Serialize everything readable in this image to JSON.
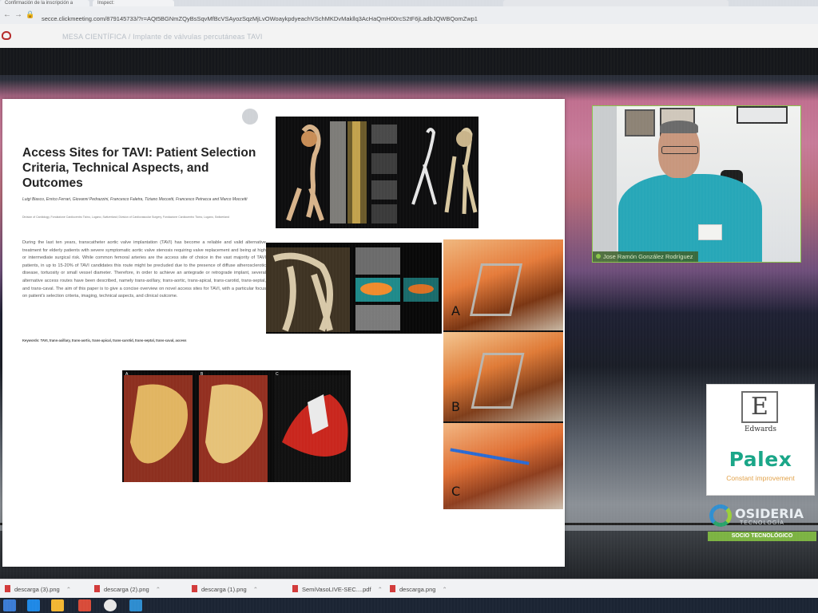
{
  "browser": {
    "tabs": [
      "Confirmación de la inscripción a",
      "Inspect:"
    ],
    "url": "secce.clickmeeting.com/879145733/?r=AQt5BGNmZQyBsSqvMfBcVSAyozSqzMjLvOWoaykpdyeachVSchMKDvMakllq3AcHaQmH00rcS2tF6jLadbJQWBQomZwp1"
  },
  "app_header": {
    "session_title": "MESA CIENTÍFICA / Implante de válvulas percutáneas TAVI"
  },
  "slide": {
    "title": "Access Sites for TAVI: Patient Selection Criteria, Technical Aspects, and Outcomes",
    "authors": "Luigi Biasco, Enrico Ferrari, Giovanni Pedrazzini, Francesco Faletra, Tiziano Moccetti, Francesco Petracca and Marco Moccetti",
    "affiliation": "Division of Cardiology, Fondazione Cardiocentro Ticino, Lugano, Switzerland; Division of Cardiovascular Surgery, Fondazione Cardiocentro Ticino, Lugano, Switzerland",
    "abstract": "During the last ten years, transcatheter aortic valve implantation (TAVI) has become a reliable and valid alternative treatment for elderly patients with severe symptomatic aortic valve stenosis requiring valve replacement and being at high or intermediate surgical risk. While common femoral arteries are the access site of choice in the vast majority of TAVI patients, in up to 15-20% of TAVI candidates this route might be precluded due to the presence of diffuse atherosclerotic disease, tortuosity or small vessel diameter. Therefore, in order to achieve an antegrade or retrograde implant, several alternative access routes have been described, namely trans-axillary, trans-aortic, trans-apical, trans-carotid, trans-septal, and trans-caval. The aim of this paper is to give a concise overview on novel access sites for TAVI, with a particular focus on patient's selection criteria, imaging, technical aspects, and clinical outcome.",
    "keywords": "Keywords: TAVI, trans-axillary, trans-aortic, trans-apical, trans-carotid, trans-septal, trans-caval, access",
    "figure_panels": [
      "A",
      "B",
      "C"
    ],
    "ct_panels": [
      "A",
      "B",
      "C"
    ]
  },
  "webcam": {
    "speaker_name": "Jose Ramón González Rodríguez"
  },
  "sponsors": {
    "edwards": "Edwards",
    "edwards_mark": "E",
    "palex": "Palex",
    "palex_tagline": "Constant improvement",
    "osideria": "OSIDERIA",
    "osideria_sub": "TECNOLOGÍA",
    "osideria_bar": "SOCIO TECNOLÓGICO"
  },
  "downloads": [
    {
      "name": "descarga (3).png"
    },
    {
      "name": "descarga (2).png"
    },
    {
      "name": "descarga (1).png"
    },
    {
      "name": "SemiVasoLIVE-SEC....pdf"
    },
    {
      "name": "descarga.png"
    }
  ],
  "colors": {
    "accent_green": "#8ac449",
    "palex_teal": "#18a587",
    "scrub_blue": "#27a7b8"
  }
}
